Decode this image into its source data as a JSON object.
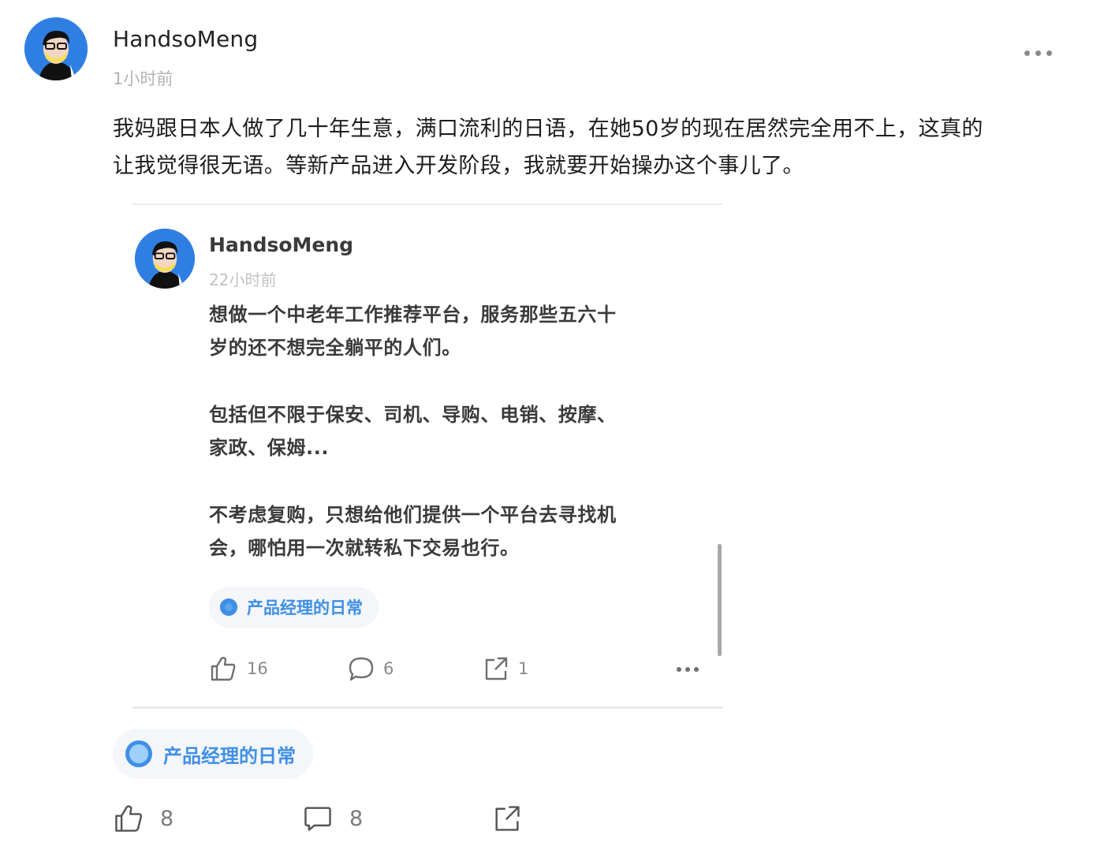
{
  "post": {
    "author": "HandsoMeng",
    "time": "1小时前",
    "content_line1": "我妈跟日本人做了几十年生意，满口流利的日语，在她50岁的现在居然完全用不上，这真的",
    "content_line2": "让我觉得很无语。等新产品进入开发阶段，我就要开始操办这个事儿了。",
    "topic": "产品经理的日常",
    "likes": "8",
    "comments": "8"
  },
  "quoted": {
    "author": "HandsoMeng",
    "time": "22小时前",
    "para1_line1": "想做一个中老年工作推荐平台，服务那些五六十",
    "para1_line2": "岁的还不想完全躺平的人们。",
    "para2_line1": "包括但不限于保安、司机、导购、电销、按摩、",
    "para2_line2": "家政、保姆...",
    "para3_line1": "不考虑复购，只想给他们提供一个平台去寻找机",
    "para3_line2": "会，哪怕用一次就转私下交易也行。",
    "topic": "产品经理的日常",
    "likes": "16",
    "comments": "6",
    "shares": "1"
  },
  "icons": {
    "like": "thumbs-up-icon",
    "comment": "comment-bubble-icon",
    "share": "share-icon",
    "more": "more-dots-icon",
    "topic": "topic-circle-icon"
  },
  "colors": {
    "accent_blue": "#3f8fe6",
    "avatar_bg": "#2f7fe3",
    "tag_bg": "#f4f6f9",
    "meta_gray": "#b3b3b3"
  }
}
